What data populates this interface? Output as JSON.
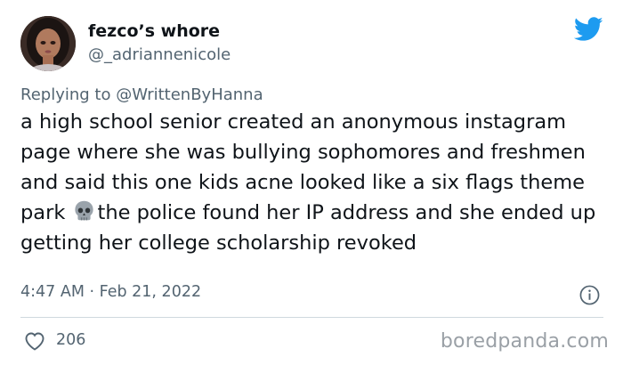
{
  "author": {
    "display_name": "fezco’s whore",
    "handle": "@_adriannenicole"
  },
  "reply": {
    "prefix": "Replying to ",
    "mention": "@WrittenByHanna"
  },
  "tweet": {
    "text_before_emoji": "a high school senior created an anonymous instagram page where she was bullying sophomores and freshmen and said this one kids acne looked like a six flags theme park ",
    "emoji": "skull",
    "text_after_emoji": "the police found her IP address and she ended up getting her college scholarship revoked",
    "timestamp": "4:47 AM · Feb 21, 2022"
  },
  "engagement": {
    "likes": "206"
  },
  "watermark": "boredpanda.com",
  "colors": {
    "text": "#0f1419",
    "secondary": "#536471",
    "twitter_blue": "#1d9bf0",
    "divider": "#cfd9de"
  },
  "icons": {
    "brand": "twitter-bird-icon",
    "info": "info-icon",
    "like": "heart-icon"
  }
}
